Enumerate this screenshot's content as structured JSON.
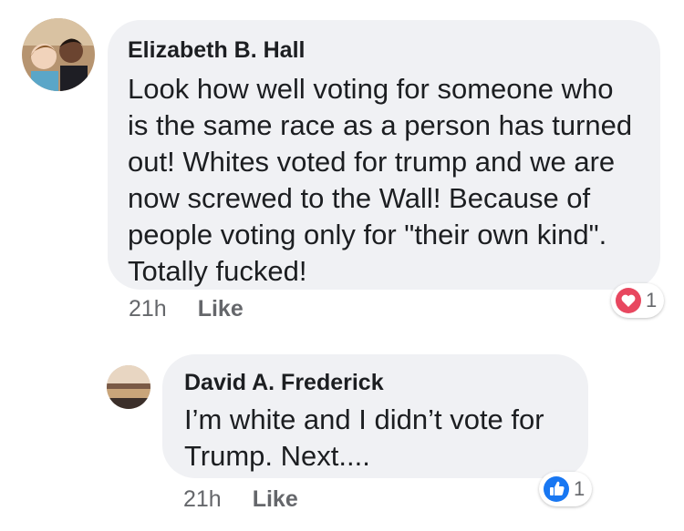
{
  "comments": [
    {
      "author": "Elizabeth B. Hall",
      "text": "Look how well voting for someone who is the same race as a person has turned out! Whites voted for trump and we are now screwed to the Wall! Because of people voting only for \"their own kind\". Totally fucked!",
      "time": "21h",
      "like_label": "Like",
      "reaction_type": "heart-icon",
      "reaction_count": "1",
      "reaction_color": "#e8475f"
    },
    {
      "author": "David A. Frederick",
      "text": "I’m white and I didn’t vote for Trump.  Next....",
      "time": "21h",
      "like_label": "Like",
      "reaction_type": "thumbs-up-icon",
      "reaction_count": "1",
      "reaction_color": "#1877f2"
    }
  ]
}
